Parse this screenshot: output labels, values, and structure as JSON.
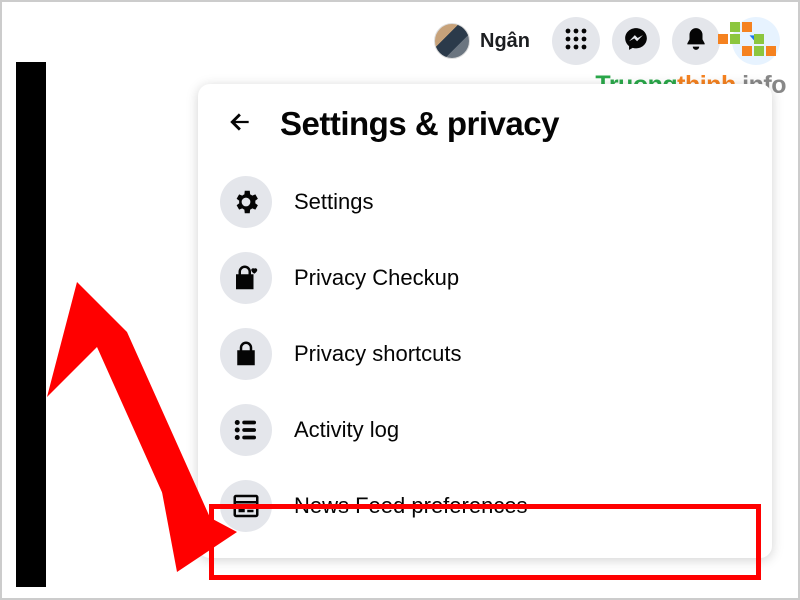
{
  "topbar": {
    "profile_name": "Ngân"
  },
  "watermark": {
    "text_a": "Truong",
    "text_b": "thinh",
    "text_c": ".info",
    "color_a": "#2aa84a",
    "color_b": "#f58220",
    "color_c": "#888888"
  },
  "panel": {
    "title": "Settings & privacy",
    "items": [
      {
        "label": "Settings",
        "icon": "gear"
      },
      {
        "label": "Privacy Checkup",
        "icon": "lock-heart"
      },
      {
        "label": "Privacy shortcuts",
        "icon": "lock"
      },
      {
        "label": "Activity log",
        "icon": "list"
      },
      {
        "label": "News Feed preferences",
        "icon": "feed"
      }
    ]
  },
  "highlight": {
    "item_index": 4
  },
  "colors": {
    "icon_bg": "#e4e6eb",
    "accent_blue": "#1877f2",
    "red": "#ff0000"
  }
}
